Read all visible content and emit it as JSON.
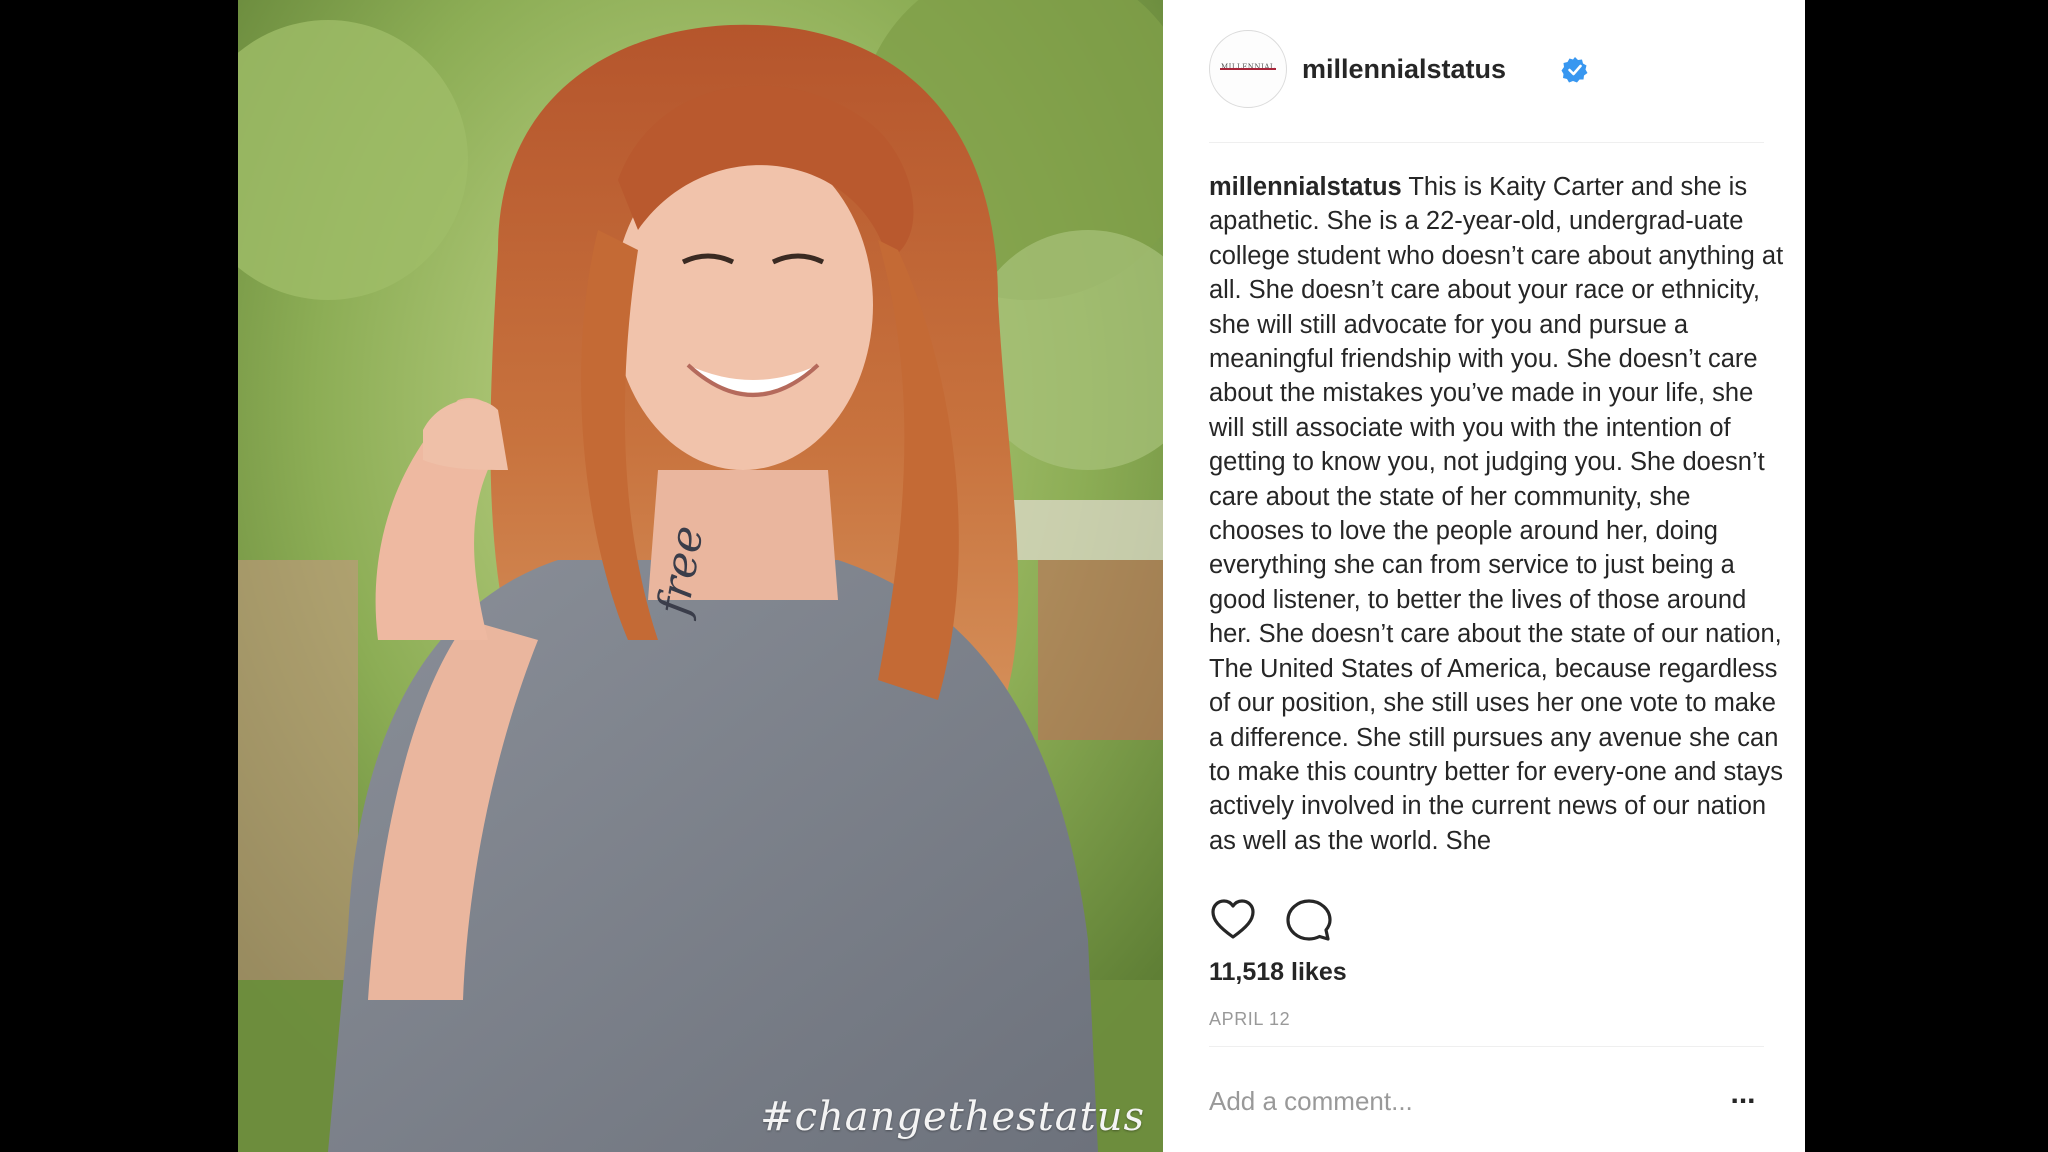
{
  "post": {
    "username": "millennialstatus",
    "avatar_text": "MILLENNIAL",
    "verified": true,
    "caption_user": "millennialstatus",
    "caption_text": "This is Kaity Carter and she is apathetic. She is a 22-year-old, undergrad-uate college student who doesn’t care about anything at all. She doesn’t care about your race or ethnicity, she will still advocate for you and pursue a meaningful friendship with you. She doesn’t care about the mistakes you’ve made in your life, she will still associate with you with the intention of getting to know you, not judging you. She doesn’t care about the state of her community, she chooses to love the people around her, doing everything she can from service to just being a good listener, to better the lives of those around her. She doesn’t care about the state of our nation, The United States of America, because regardless of our position, she still uses her one vote to make a difference. She still pursues any avenue she can to make this country better for every-one and stays actively involved in the current news of our nation as well as the world. She",
    "likes": "11,518 likes",
    "date": "APRIL 12",
    "comment_placeholder": "Add a comment...",
    "more_label": "..."
  },
  "photo": {
    "hashtag": "#changethestatus",
    "tattoo": "free"
  },
  "icons": {
    "like": "heart-icon",
    "comment": "comment-icon",
    "verified": "verified-badge-icon",
    "more": "more-options-icon"
  },
  "colors": {
    "verified_blue": "#3897f0",
    "text": "#262626",
    "muted": "#999999",
    "divider": "#efefef"
  }
}
